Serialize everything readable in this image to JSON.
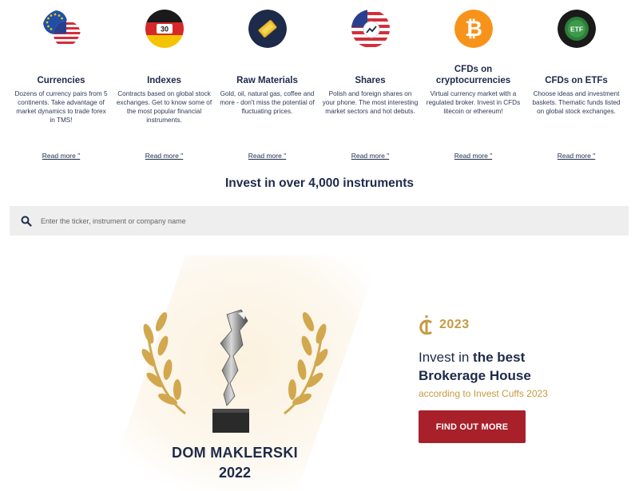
{
  "instruments": [
    {
      "title": "Currencies",
      "icon": "eu-us-flag-icon",
      "description": "Dozens of currency pairs from 5 continents. Take advantage of market dynamics to trade forex in TMS!",
      "link": "Read more \""
    },
    {
      "title": "Indexes",
      "icon": "german-flag-icon",
      "icon_text": "30",
      "description": "Contracts based on global stock exchanges. Get to know some of the most popular financial instruments.",
      "link": "Read more \""
    },
    {
      "title": "Raw Materials",
      "icon": "gold-bar-icon",
      "description": "Gold, oil, natural gas, coffee and more - don't miss the potential of fluctuating prices.",
      "link": "Read more \""
    },
    {
      "title": "Shares",
      "icon": "us-flag-chart-icon",
      "description": "Polish and foreign shares on your phone. The most interesting market sectors and hot debuts.",
      "link": "Read more \""
    },
    {
      "title": "CFDs on cryptocurrencies",
      "icon": "bitcoin-icon",
      "description": "Virtual currency market with a regulated broker. Invest in CFDs litecoin or ethereum!",
      "link": "Read more \""
    },
    {
      "title": "CFDs on ETFs",
      "icon": "etf-icon",
      "icon_text": "ETF",
      "description": "Choose ideas and investment baskets. Thematic funds listed on global stock exchanges.",
      "link": "Read more \""
    }
  ],
  "headline": "Invest in over 4,000 instruments",
  "search": {
    "placeholder": "Enter the ticker, instrument or company name",
    "icon": "search-icon"
  },
  "award": {
    "line1": "DOM MAKLERSKI",
    "line2": "2022"
  },
  "promo": {
    "badge_year": "2023",
    "line1_prefix": "Invest in ",
    "line1_bold": "the best",
    "line2": "Brokerage House",
    "line3": "according to Invest Cuffs 2023",
    "button": "FIND OUT MORE"
  },
  "colors": {
    "navy": "#1e2a4a",
    "gold": "#c59a42",
    "red": "#a8202a",
    "search_bg": "#eeeeee"
  }
}
